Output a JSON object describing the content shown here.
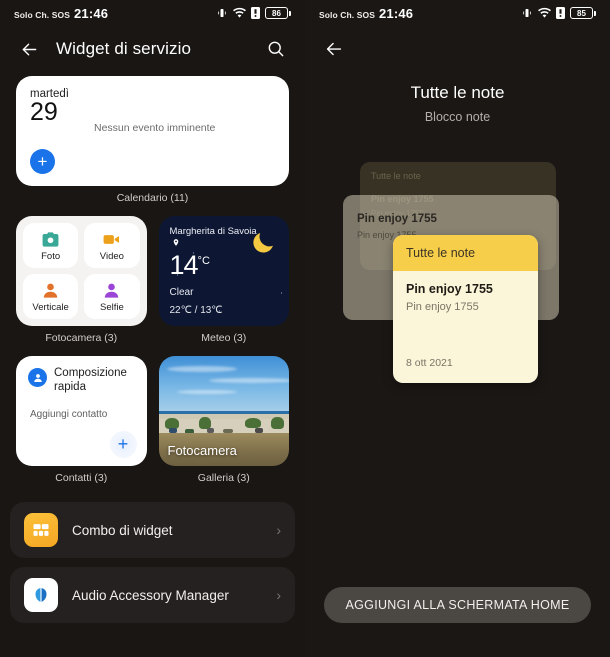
{
  "left": {
    "status": {
      "carrier": "Solo Ch. SOS",
      "time": "21:46",
      "battery": "86",
      "icons": [
        "vibrate-icon",
        "wifi-icon",
        "sim-icon",
        "battery-icon"
      ]
    },
    "appbar": {
      "back": "back-arrow-icon",
      "title": "Widget di servizio",
      "search": "search-icon"
    },
    "widgets": [
      {
        "id": "calendar",
        "label": "Calendario (11)",
        "day": "martedì",
        "date": "29",
        "empty_text": "Nessun evento imminente",
        "fab": "+"
      },
      {
        "id": "camera",
        "label": "Fotocamera (3)",
        "tiles": [
          {
            "name": "Foto",
            "icon": "photo-camera-icon",
            "color": "#3aa896"
          },
          {
            "name": "Video",
            "icon": "video-camera-icon",
            "color": "#eda11a"
          },
          {
            "name": "Verticale",
            "icon": "portrait-icon",
            "color": "#e2712a"
          },
          {
            "name": "Selfie",
            "icon": "selfie-icon",
            "color": "#9b45d6"
          }
        ]
      },
      {
        "id": "weather",
        "label": "Meteo (3)",
        "city": "Margherita di Savoia",
        "temp": "14",
        "unit": "°C",
        "condition": "Clear",
        "range": "22℃  /  13℃",
        "icon": "crescent-moon-icon",
        "pin": "location-pin-icon",
        "bg": "#0d1733",
        "accent": "#f5c842"
      },
      {
        "id": "contacts",
        "label": "Contatti (3)",
        "title": "Composizione rapida",
        "subtitle": "Aggiungi contatto",
        "avatar": "contact-avatar-icon",
        "fab": "+"
      },
      {
        "id": "gallery",
        "label": "Galleria (3)",
        "caption": "Fotocamera"
      }
    ],
    "list": [
      {
        "label": "Combo di widget",
        "icon": "widget-combo-icon",
        "chevron": "›"
      },
      {
        "label": "Audio Accessory Manager",
        "icon": "audio-accessory-icon",
        "chevron": "›"
      }
    ]
  },
  "right": {
    "status": {
      "carrier": "Solo Ch. SOS",
      "time": "21:46",
      "battery": "85"
    },
    "back": "back-arrow-icon",
    "title": "Tutte le note",
    "subtitle": "Blocco note",
    "cards": {
      "back": {
        "header": "Tutte le note",
        "line1": "Pin enjoy 1755",
        "line2": "Pin enjoy 1755"
      },
      "middle": {
        "title": "Pin enjoy 1755",
        "subtitle": "Pin enjoy 1755"
      },
      "front": {
        "header": "Tutte le note",
        "title": "Pin enjoy 1755",
        "subtitle": "Pin enjoy 1755",
        "date": "8 ott 2021",
        "header_color": "#f6ce49",
        "body_color": "#fbf5d9"
      }
    },
    "cta": "AGGIUNGI ALLA SCHERMATA HOME"
  }
}
